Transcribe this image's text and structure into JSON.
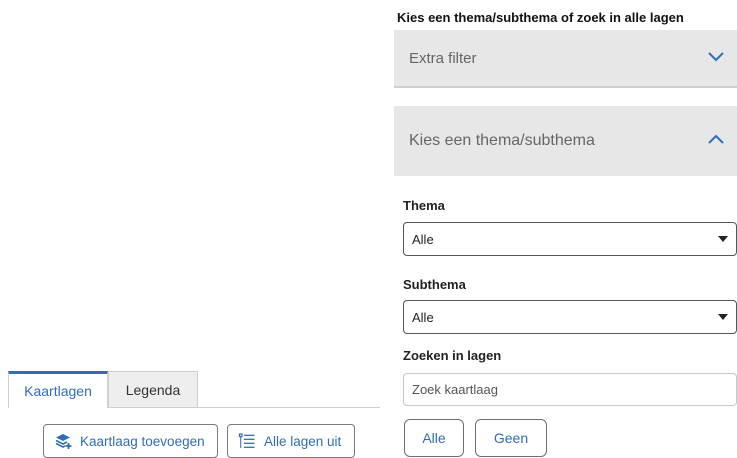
{
  "left_panel": {
    "tabs": [
      {
        "label": "Kaartlagen",
        "active": true
      },
      {
        "label": "Legenda",
        "active": false
      }
    ],
    "buttons": {
      "add_layer": {
        "label": "Kaartlaag toevoegen",
        "icon": "layers-add-icon"
      },
      "all_layers_off": {
        "label": "Alle lagen uit",
        "icon": "list-off-icon"
      }
    }
  },
  "right_panel": {
    "title": "Kies een thema/subthema of zoek in alle lagen",
    "extra_filter": {
      "label": "Extra filter",
      "expanded": false
    },
    "thema_section": {
      "label": "Kies een thema/subthema",
      "expanded": true
    },
    "thema": {
      "label": "Thema",
      "value": "Alle"
    },
    "subthema": {
      "label": "Subthema",
      "value": "Alle"
    },
    "search": {
      "label": "Zoeken in lagen",
      "placeholder": "Zoek kaartlaag"
    },
    "buttons": {
      "all": "Alle",
      "none": "Geen"
    }
  },
  "colors": {
    "accent": "#2f6eb5",
    "header_bg": "#e7e7e7",
    "tab_inactive_bg": "#eeeeee"
  }
}
